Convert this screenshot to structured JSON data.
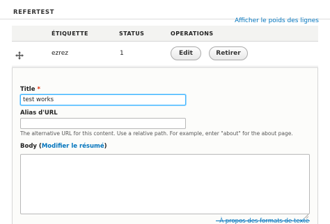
{
  "field": {
    "legend": "REFERTEST",
    "weight_link": "Afficher le poids des lignes"
  },
  "table": {
    "headers": [
      "ÉTIQUETTE",
      "STATUS",
      "OPERATIONS"
    ],
    "rows": [
      {
        "label": "ezrez",
        "status": "1",
        "edit": "Edit",
        "remove": "Retirer"
      }
    ]
  },
  "form": {
    "title_label": "Title",
    "required_mark": "*",
    "title_value": "test works",
    "alias_label": "Alias d'URL",
    "alias_value": "",
    "alias_description": "The alternative URL for this content. Use a relative path. For example, enter \"about\" for the about page.",
    "body_label": "Body",
    "body_summary_link": "Modifier le résumé",
    "body_value": "",
    "formats_link": "À propos des formats de texte"
  },
  "icons": {
    "drag": "move-cross-icon",
    "resize": "resize-grip-icon"
  },
  "colors": {
    "link": "#0074bd",
    "required": "#e32700",
    "focus": "#40b6ff",
    "header_bg": "#f3f3f1"
  }
}
